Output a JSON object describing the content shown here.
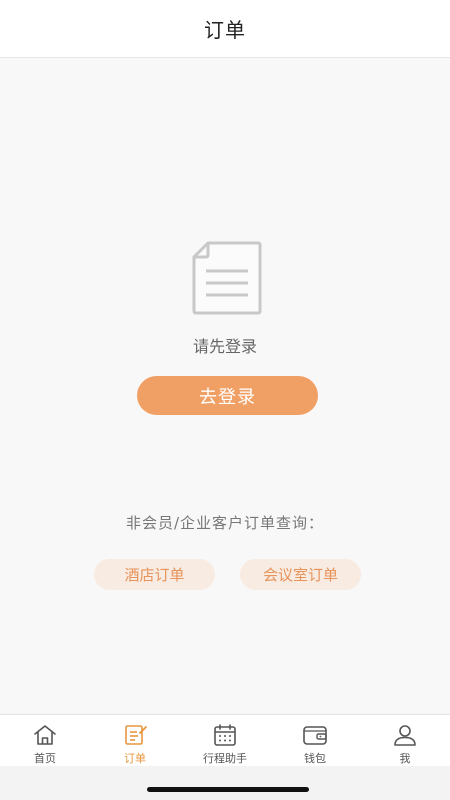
{
  "header": {
    "title": "订单"
  },
  "empty_state": {
    "icon": "document-icon",
    "message": "请先登录",
    "login_button": "去登录"
  },
  "guest_query": {
    "label": "非会员/企业客户订单查询：",
    "buttons": [
      {
        "label": "酒店订单"
      },
      {
        "label": "会议室订单"
      }
    ]
  },
  "tabbar": {
    "active_color": "#e8963f",
    "items": [
      {
        "label": "首页",
        "icon": "home-icon"
      },
      {
        "label": "订单",
        "icon": "order-icon",
        "active": true
      },
      {
        "label": "行程助手",
        "icon": "calendar-icon"
      },
      {
        "label": "钱包",
        "icon": "wallet-icon"
      },
      {
        "label": "我",
        "icon": "person-icon"
      }
    ]
  }
}
